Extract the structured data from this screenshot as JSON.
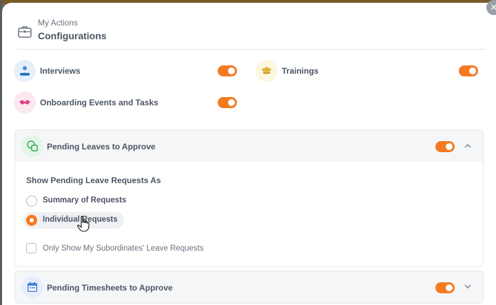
{
  "header": {
    "subtitle": "My Actions",
    "title": "Configurations"
  },
  "items": {
    "interviews": {
      "label": "Interviews",
      "enabled": true
    },
    "trainings": {
      "label": "Trainings",
      "enabled": true
    },
    "onboarding": {
      "label": "Onboarding Events and Tasks",
      "enabled": true
    }
  },
  "pending_leaves": {
    "label": "Pending Leaves to Approve",
    "enabled": true,
    "expanded": true,
    "show_as_label": "Show Pending Leave Requests As",
    "options": [
      "Summary of Requests",
      "Individual Requests"
    ],
    "selected": "Individual Requests",
    "subordinates_label": "Only Show My Subordinates' Leave Requests",
    "subordinates_checked": false
  },
  "pending_timesheets": {
    "label": "Pending Timesheets to Approve",
    "enabled": true,
    "expanded": false
  },
  "colors": {
    "accent": "#f47a20"
  },
  "icons": {
    "header": "briefcase-icon",
    "interviews": "interview-icon",
    "trainings": "graduation-cap-icon",
    "onboarding": "handshake-icon",
    "pending_leaves": "leave-icon",
    "pending_timesheets": "calendar-icon",
    "close": "close-icon"
  }
}
